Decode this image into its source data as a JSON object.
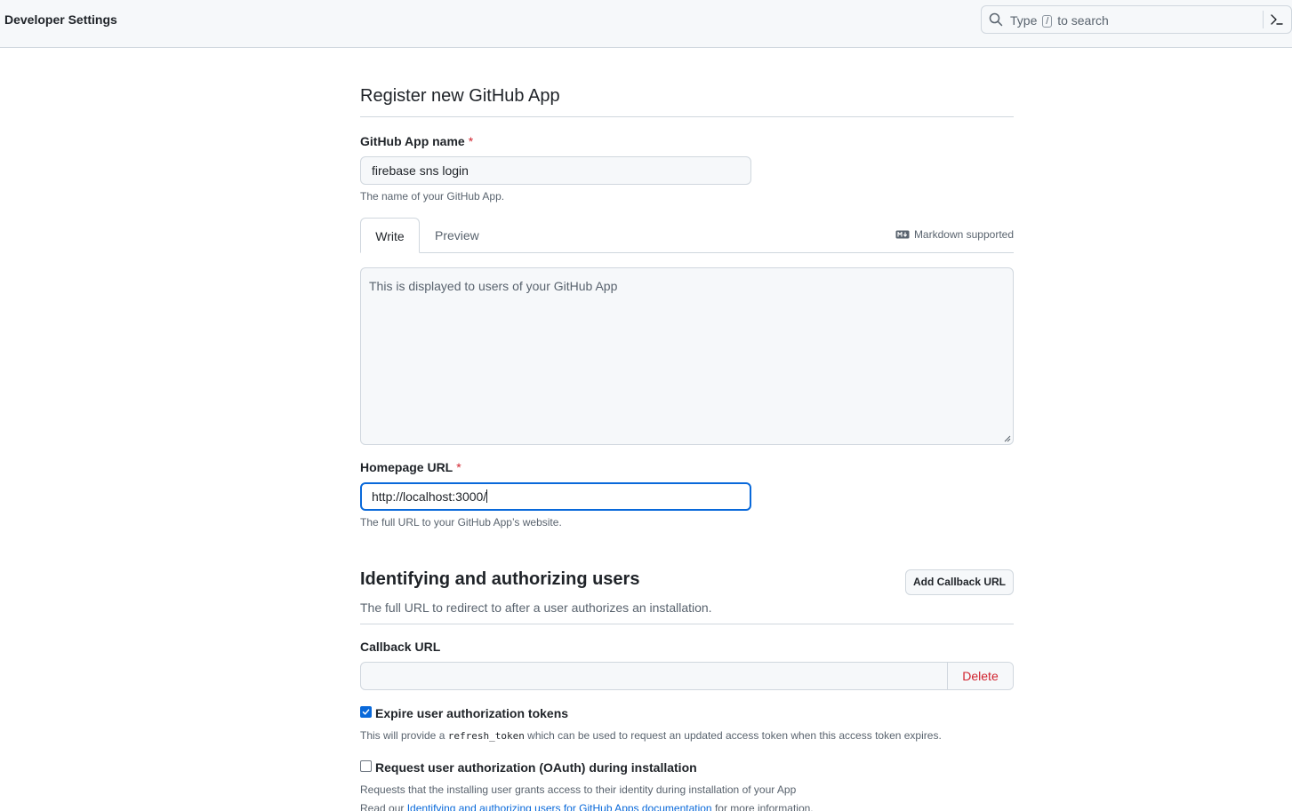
{
  "header": {
    "title": "Developer Settings",
    "search": {
      "prefix": "Type",
      "key": "/",
      "suffix": "to search"
    }
  },
  "form": {
    "title": "Register new GitHub App",
    "app_name": {
      "label": "GitHub App name",
      "required_mark": "*",
      "value": "firebase sns login",
      "note": "The name of your GitHub App."
    },
    "description": {
      "tabs": [
        "Write",
        "Preview"
      ],
      "active_tab": "Write",
      "markdown_note": "Markdown supported",
      "placeholder": "This is displayed to users of your GitHub App"
    },
    "homepage": {
      "label": "Homepage URL",
      "required_mark": "*",
      "value": "http://localhost:3000/",
      "note": "The full URL to your GitHub App’s website."
    }
  },
  "identifying": {
    "title": "Identifying and authorizing users",
    "description": "The full URL to redirect to after a user authorizes an installation.",
    "add_callback_button": "Add Callback URL",
    "callback_label": "Callback URL",
    "callback_value": "",
    "delete_button": "Delete",
    "expire_tokens": {
      "label": "Expire user authorization tokens",
      "checked": true,
      "note_before": "This will provide a",
      "note_code": "refresh_token",
      "note_after": "which can be used to request an updated access token when this access token expires."
    },
    "request_oauth": {
      "label": "Request user authorization (OAuth) during installation",
      "checked": false,
      "note": "Requests that the installing user grants access to their identity during installation of your App",
      "read_prefix": "Read our",
      "read_link": "Identifying and authorizing users for GitHub Apps documentation",
      "read_suffix": "for more information."
    }
  },
  "colors": {
    "accent": "#0969da",
    "danger": "#d1242f",
    "border": "#d0d7de",
    "muted_text": "#59636e"
  }
}
